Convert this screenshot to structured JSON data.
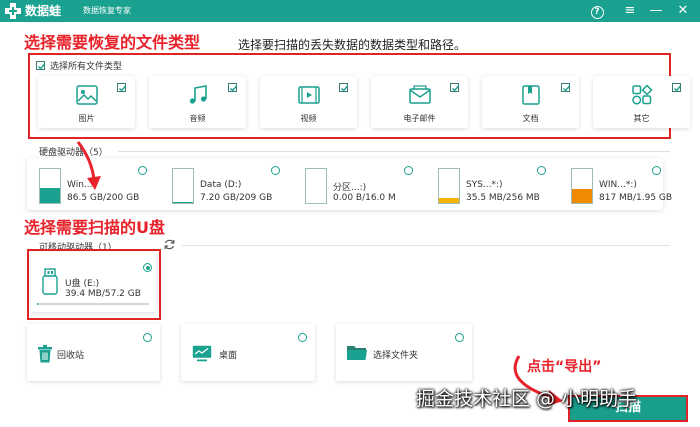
{
  "titlebar": {
    "app_name": "数据蛙",
    "subtitle": "数据恢复专家",
    "help_glyph": "?",
    "menu_glyph": "≡",
    "minimize_glyph": "—",
    "close_glyph": "✕"
  },
  "annotations": {
    "step1": "选择需要恢复的文件类型",
    "step2": "选择需要扫描的U盘",
    "step3": "点击“导出”"
  },
  "instruction": "选择要扫描的丢失数据的数据类型和路径。",
  "file_types": {
    "select_all_label": "选择所有文件类型",
    "select_all_checked": true,
    "items": [
      {
        "label": "图片",
        "icon": "image-icon",
        "checked": true
      },
      {
        "label": "音频",
        "icon": "music-icon",
        "checked": true
      },
      {
        "label": "视频",
        "icon": "video-icon",
        "checked": true
      },
      {
        "label": "电子邮件",
        "icon": "email-icon",
        "checked": true
      },
      {
        "label": "文档",
        "icon": "document-icon",
        "checked": true
      },
      {
        "label": "其它",
        "icon": "other-icon",
        "checked": true
      }
    ]
  },
  "hard_drives": {
    "label": "硬盘驱动器（5）",
    "items": [
      {
        "name": "Win...:",
        "size": "86.5 GB/200 GB",
        "used_fraction": 0.43,
        "color": "#1aa18f"
      },
      {
        "name": "Data (D:)",
        "size": "7.20 GB/209 GB",
        "used_fraction": 0.03,
        "color": "#1aa18f"
      },
      {
        "name": "分区...:)",
        "size": "0.00  B/16.0 M",
        "used_fraction": 0.0,
        "color": "#1aa18f"
      },
      {
        "name": "SYS...*:)",
        "size": "35.5 MB/256 MB",
        "used_fraction": 0.14,
        "color": "#f5b400"
      },
      {
        "name": "WIN...*:)",
        "size": "817 MB/1.95 GB",
        "used_fraction": 0.41,
        "color": "#f08a00"
      }
    ]
  },
  "removable": {
    "label": "可移动驱动器（1）",
    "refresh_icon": "refresh-icon",
    "drive": {
      "name": "U盘 (E:)",
      "size": "39.4 MB/57.2 GB",
      "used_fraction": 0.01,
      "selected": true
    }
  },
  "places": [
    {
      "label": "回收站",
      "icon": "recycle-bin-icon"
    },
    {
      "label": "桌面",
      "icon": "desktop-icon"
    },
    {
      "label": "选择文件夹",
      "icon": "folder-icon"
    }
  ],
  "watermark": "掘金技术社区 @ 小明助手",
  "export_button": "扫描",
  "colors": {
    "accent": "#1aa18f",
    "annotation_red": "#e8222a"
  }
}
